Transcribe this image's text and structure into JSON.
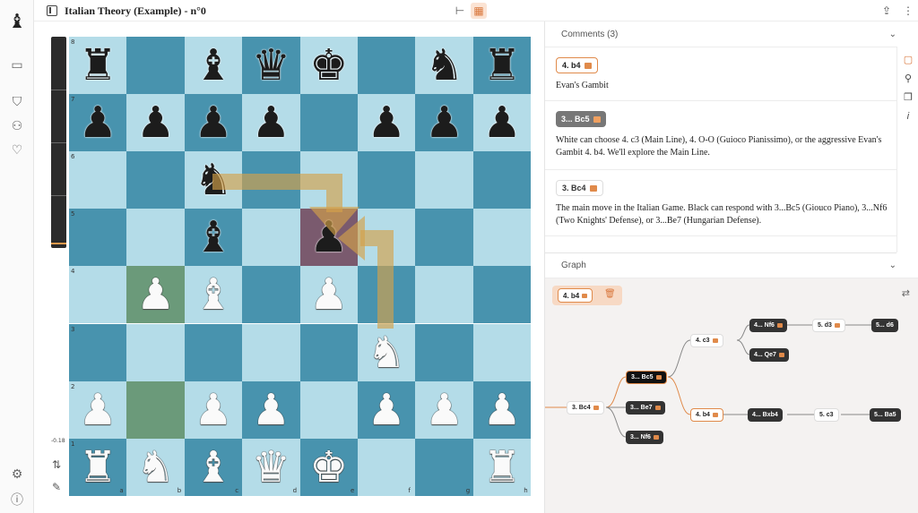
{
  "sidebar": {
    "icons": [
      "chess-bishop-logo-icon",
      "folder-icon",
      "shield-check-icon",
      "people-icon",
      "hand-heart-icon",
      "gear-icon",
      "help-icon"
    ]
  },
  "topbar": {
    "title": "Italian Theory (Example) - n°0"
  },
  "board": {
    "eval_label": "-0.18",
    "ranks": [
      "8",
      "7",
      "6",
      "5",
      "4",
      "3",
      "2",
      "1"
    ],
    "files": [
      "a",
      "b",
      "c",
      "d",
      "e",
      "f",
      "g",
      "h"
    ],
    "position": [
      [
        "r",
        "",
        "b",
        "q",
        "k",
        "",
        "n",
        "r"
      ],
      [
        "p",
        "p",
        "p",
        "p",
        "",
        "p",
        "p",
        "p"
      ],
      [
        "",
        "",
        "n",
        "",
        "",
        "",
        "",
        ""
      ],
      [
        "",
        "",
        "b",
        "",
        "p",
        "",
        "",
        ""
      ],
      [
        "",
        "P",
        "B",
        "",
        "P",
        "",
        "",
        ""
      ],
      [
        "",
        "",
        "",
        "",
        "",
        "N",
        "",
        ""
      ],
      [
        "P",
        "",
        "P",
        "P",
        "",
        "P",
        "P",
        "P"
      ],
      [
        "R",
        "N",
        "B",
        "Q",
        "K",
        "",
        "",
        "R"
      ]
    ]
  },
  "comments": {
    "header": "Comments (3)",
    "items": [
      {
        "move": "4. b4",
        "text": "Evan's Gambit"
      },
      {
        "move": "3... Bc5",
        "text": "White can choose 4. c3 (Main Line), 4. O-O (Guioco Pianissimo), or the aggressive Evan's Gambit 4. b4. We'll explore the Main Line."
      },
      {
        "move": "3. Bc4",
        "text": "The main move in the Italian Game. Black can respond with 3...Bc5 (Giouco Piano), 3...Nf6 (Two Knights' Defense), or 3...Be7 (Hungarian Defense)."
      }
    ]
  },
  "graph": {
    "header": "Graph",
    "selected": "4. b4",
    "nodes": [
      "3. Bc4",
      "3... Bc5",
      "3... Be7",
      "3... Nf6",
      "4. c3",
      "4. b4",
      "4... Nf6",
      "4... Qe7",
      "5. d3",
      "5... d6",
      "4... Bxb4",
      "5. c3",
      "5... Ba5"
    ]
  },
  "colors": {
    "accent": "#e08a4a",
    "board_light": "#b4dce8",
    "board_dark": "#4893ae"
  }
}
